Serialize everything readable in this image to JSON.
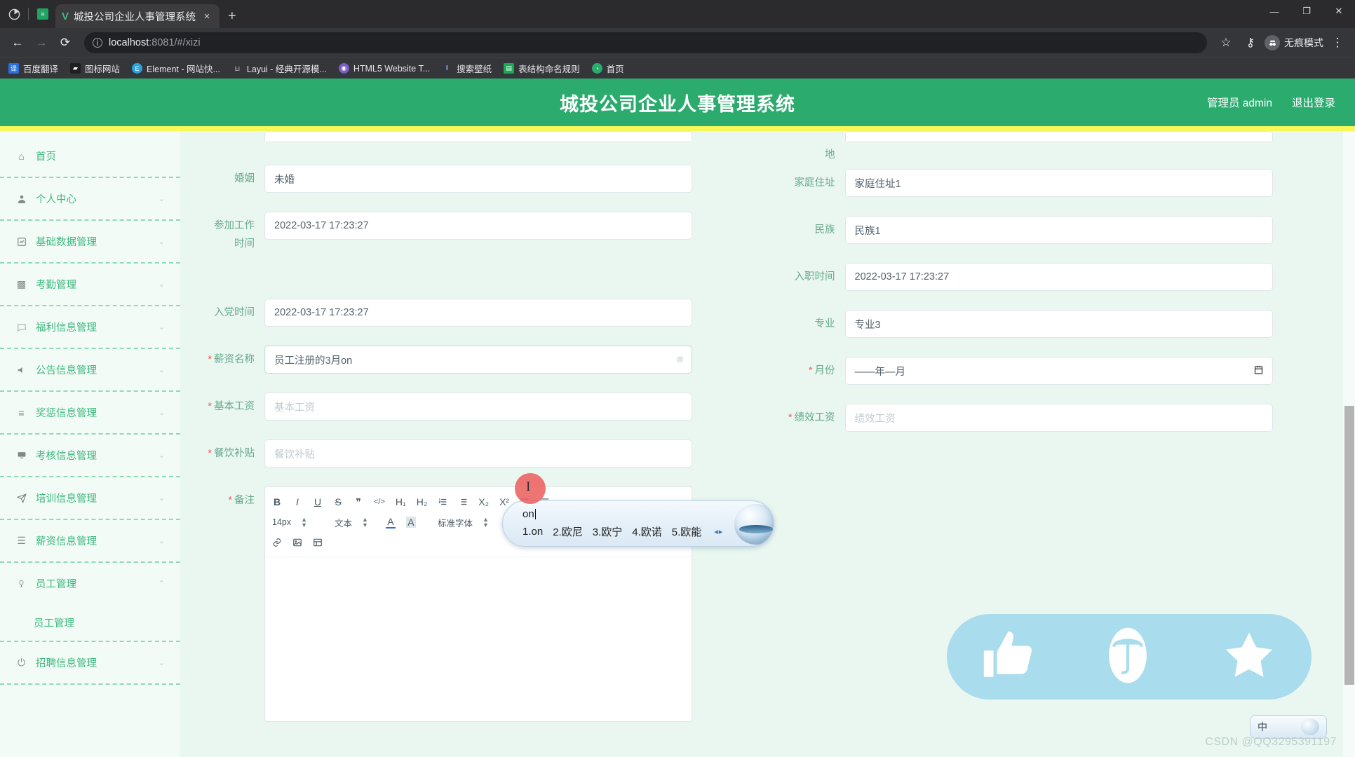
{
  "browser": {
    "tab": {
      "title": "城投公司企业人事管理系统",
      "favicon": "vue-icon",
      "close": "×"
    },
    "newtab_label": "+",
    "window_controls": {
      "minimize": "—",
      "maximize": "❐",
      "close": "✕"
    },
    "toolbar": {
      "back": "←",
      "forward": "→",
      "reload": "⟳",
      "url_host": "localhost",
      "url_rest": ":8081/#/xizi",
      "star": "☆",
      "key": "⚷",
      "incognito_label": "无痕模式",
      "menu": "⋮"
    },
    "bookmarks": [
      {
        "label": "百度翻译",
        "icon_color": "#2a70d8"
      },
      {
        "label": "图标网站",
        "icon_color": "#1f1f1f"
      },
      {
        "label": "Element - 网站快...",
        "icon_color": "#26a5e4"
      },
      {
        "label": "Layui - 经典开源模...",
        "icon_color": "#3b4049"
      },
      {
        "label": "HTML5 Website T...",
        "icon_color": "#7b5cc7"
      },
      {
        "label": "搜索壁纸",
        "icon_color": "#4a5bd0"
      },
      {
        "label": "表结构命名规则",
        "icon_color": "#1aaa55"
      },
      {
        "label": "首页",
        "icon_color": "#2bab6e"
      }
    ]
  },
  "header": {
    "title": "城投公司企业人事管理系统",
    "user": "管理员 admin",
    "logout": "退出登录",
    "brand_color": "#2bab6e",
    "accent_bar_color": "#f7f75a"
  },
  "sidebar": {
    "items": [
      {
        "label": "首页",
        "icon": "home-icon",
        "arrow": ""
      },
      {
        "label": "个人中心",
        "icon": "user-icon",
        "arrow": "⌄"
      },
      {
        "label": "基础数据管理",
        "icon": "chart-icon",
        "arrow": "⌄"
      },
      {
        "label": "考勤管理",
        "icon": "calendar-icon",
        "arrow": "⌄"
      },
      {
        "label": "福利信息管理",
        "icon": "message-icon",
        "arrow": "⌄"
      },
      {
        "label": "公告信息管理",
        "icon": "megaphone-icon",
        "arrow": "⌄"
      },
      {
        "label": "奖惩信息管理",
        "icon": "list-icon",
        "arrow": "⌄"
      },
      {
        "label": "考核信息管理",
        "icon": "monitor-icon",
        "arrow": "⌄"
      },
      {
        "label": "培训信息管理",
        "icon": "send-icon",
        "arrow": "⌄"
      },
      {
        "label": "薪资信息管理",
        "icon": "rows-icon",
        "arrow": "⌄"
      },
      {
        "label": "员工管理",
        "icon": "badge-icon",
        "arrow": "⌃"
      }
    ],
    "submenu": {
      "parent": "员工管理",
      "label": "员工管理"
    },
    "tail_items": [
      {
        "label": "招聘信息管理",
        "icon": "power-icon",
        "arrow": "⌄"
      }
    ]
  },
  "form": {
    "left": [
      {
        "label": "婚姻",
        "value": "未婚",
        "placeholder": "",
        "required": false,
        "type": "text"
      },
      {
        "label": "参加工作时间",
        "value": "2022-03-17 17:23:27",
        "placeholder": "",
        "required": false,
        "type": "text"
      },
      {
        "label": "入党时间",
        "value": "2022-03-17 17:23:27",
        "placeholder": "",
        "required": false,
        "type": "text"
      },
      {
        "label": "薪资名称",
        "value": "员工注册的3月on",
        "placeholder": "",
        "required": true,
        "type": "text-clear",
        "suffix": "⊗"
      },
      {
        "label": "基本工资",
        "value": "",
        "placeholder": "基本工资",
        "required": true,
        "type": "text"
      },
      {
        "label": "餐饮补贴",
        "value": "",
        "placeholder": "餐饮补贴",
        "required": true,
        "type": "text"
      }
    ],
    "right": [
      {
        "label": "地",
        "value": "",
        "placeholder": "",
        "required": false,
        "type": "label-only"
      },
      {
        "label": "家庭住址",
        "value": "家庭住址1",
        "placeholder": "",
        "required": false,
        "type": "text"
      },
      {
        "label": "民族",
        "value": "民族1",
        "placeholder": "",
        "required": false,
        "type": "text"
      },
      {
        "label": "入职时间",
        "value": "2022-03-17 17:23:27",
        "placeholder": "",
        "required": false,
        "type": "text"
      },
      {
        "label": "专业",
        "value": "专业3",
        "placeholder": "",
        "required": false,
        "type": "text"
      },
      {
        "label": "月份",
        "value": "——年—月",
        "placeholder": "",
        "required": true,
        "type": "month"
      },
      {
        "label": "绩效工资",
        "value": "",
        "placeholder": "绩效工资",
        "required": true,
        "type": "text"
      }
    ],
    "remark": {
      "label": "备注",
      "required": true,
      "toolbar_row1": [
        "B",
        "I",
        "U",
        "S",
        "❞",
        "</>",
        "H₁",
        "H₂",
        "ordered-list",
        "bullet-list",
        "X₂",
        "X²",
        "outdent",
        "indent"
      ],
      "font_size": "14px",
      "text_style": "文本",
      "font_family": "标准字体",
      "color_icon": "A",
      "bg_color_icon": "A",
      "align_icon": "align-icon",
      "clear_format_icon": "Tx",
      "toolbar_row3": [
        "link-icon",
        "image-icon",
        "table-icon"
      ],
      "content": ""
    }
  },
  "ime": {
    "typed": "on",
    "candidates": [
      "1.on",
      "2.欧尼",
      "3.欧宁",
      "4.欧诺",
      "5.欧能"
    ],
    "nav": "◂▸"
  },
  "ime_status": {
    "mode": "中"
  },
  "social": {
    "buttons": [
      {
        "name": "thumbs-up",
        "glyph": "👍"
      },
      {
        "name": "umbrella",
        "glyph": "☂"
      },
      {
        "name": "star",
        "glyph": "★"
      }
    ],
    "background": "#a9dced"
  },
  "watermark": "CSDN @QQ3295391197"
}
